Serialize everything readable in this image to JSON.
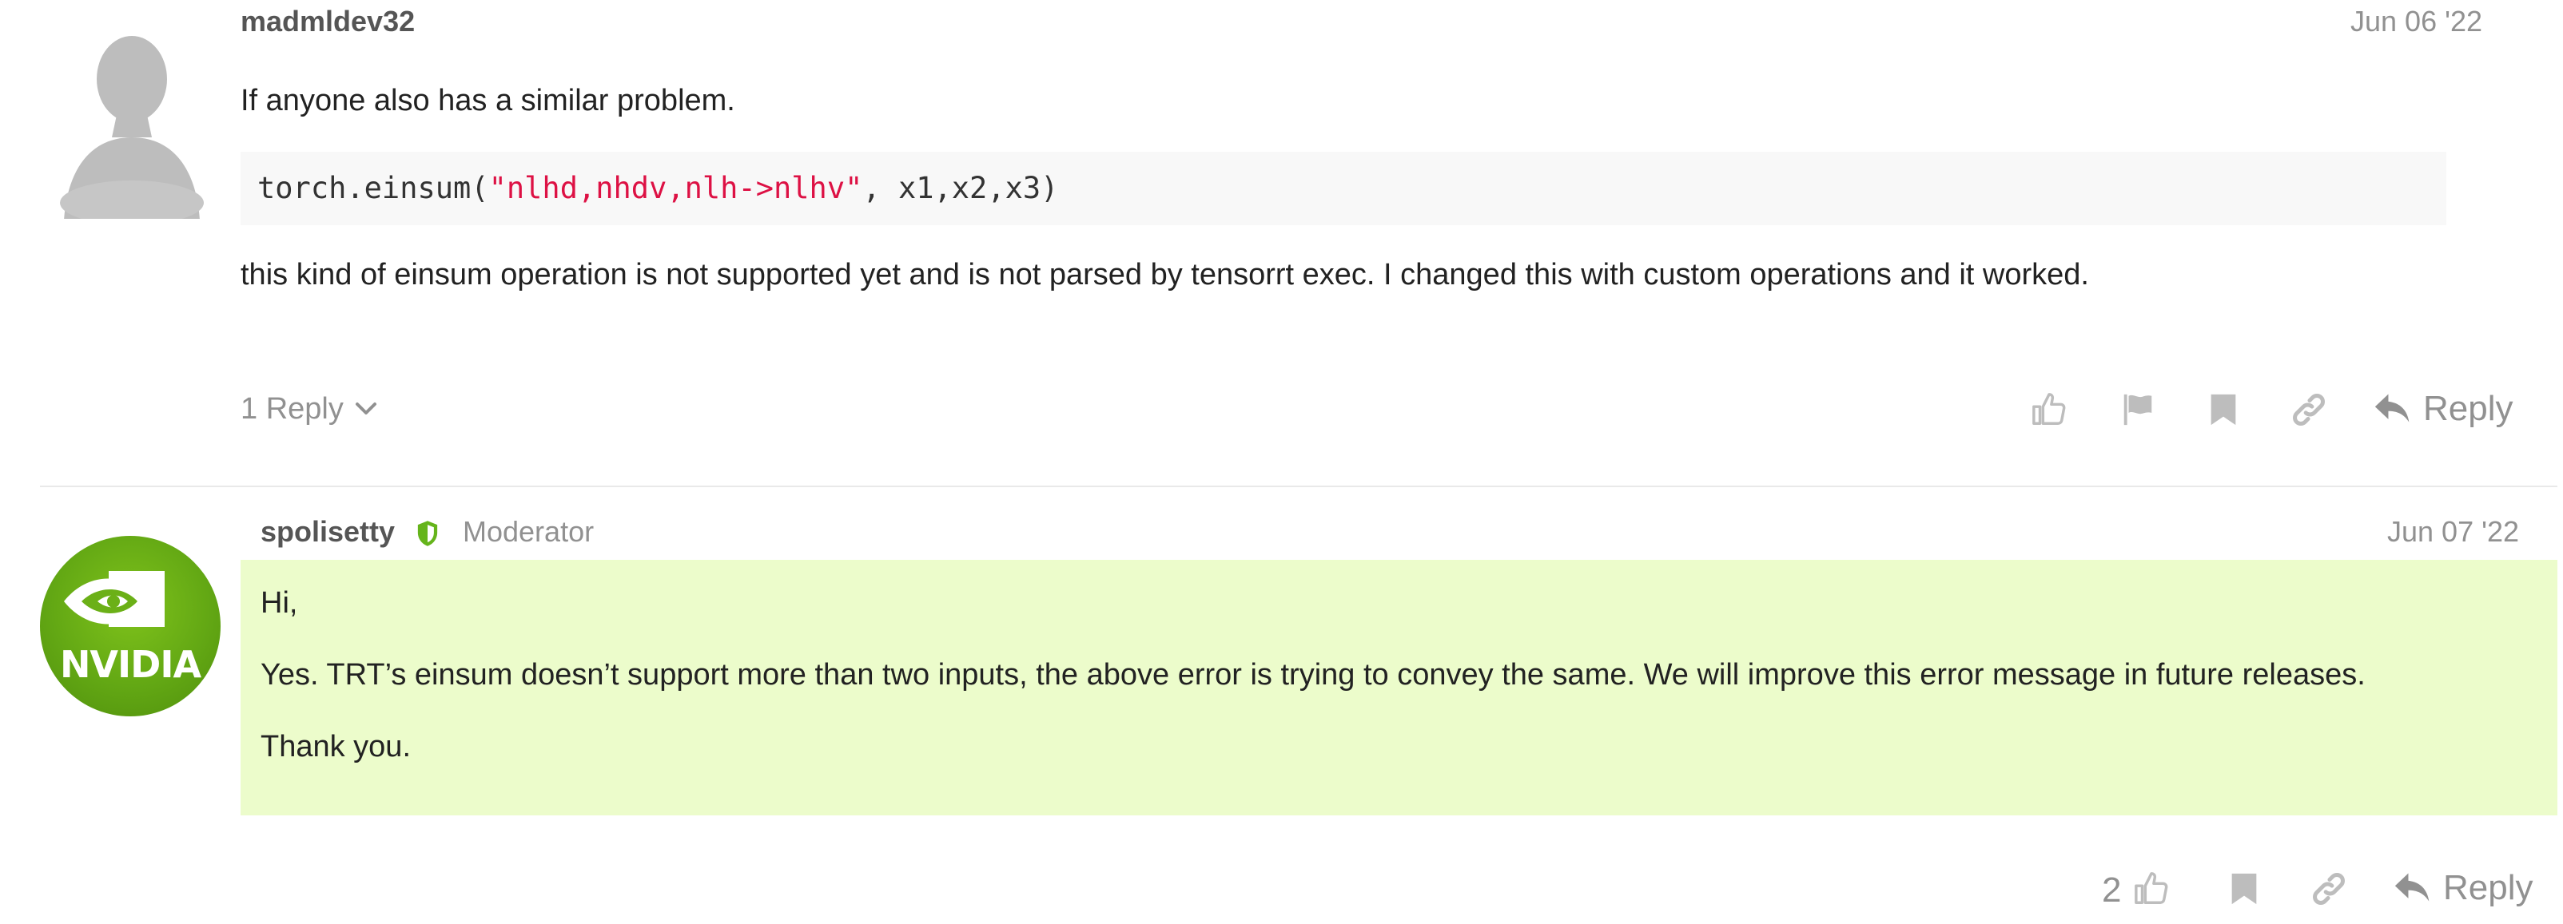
{
  "post1": {
    "username": "madmldev32",
    "date": "Jun 06 '22",
    "intro": "If anyone also has a similar problem.",
    "code": {
      "prefix": "torch.einsum(",
      "string": "\"nlhd,nhdv,nlh->nlhv\"",
      "suffix": ", x1,x2,x3)"
    },
    "text": "this kind of einsum operation is not supported yet and is not parsed by tensorrt exec. I changed this with custom operations and it worked.",
    "replies_label": "1 Reply",
    "actions": {
      "like_icon": "thumbs-up-icon",
      "flag_icon": "flag-icon",
      "bookmark_icon": "bookmark-icon",
      "link_icon": "link-icon",
      "reply_label": "Reply"
    }
  },
  "post2": {
    "username": "spolisetty",
    "title": "Moderator",
    "date": "Jun 07 '22",
    "avatar_text": "NVIDIA",
    "paragraphs": [
      "Hi,",
      "Yes. TRT’s einsum doesn’t support more than two inputs, the above error is trying to convey the same. We will improve this error message in future releases.",
      "Thank you."
    ],
    "like_count": "2",
    "actions": {
      "like_icon": "thumbs-up-icon",
      "bookmark_icon": "bookmark-icon",
      "link_icon": "link-icon",
      "reply_label": "Reply"
    }
  },
  "colors": {
    "highlight_bg": "#ecfccb",
    "code_string": "#dd1144",
    "muted": "#919191",
    "nvidia_green": "#76b900"
  }
}
